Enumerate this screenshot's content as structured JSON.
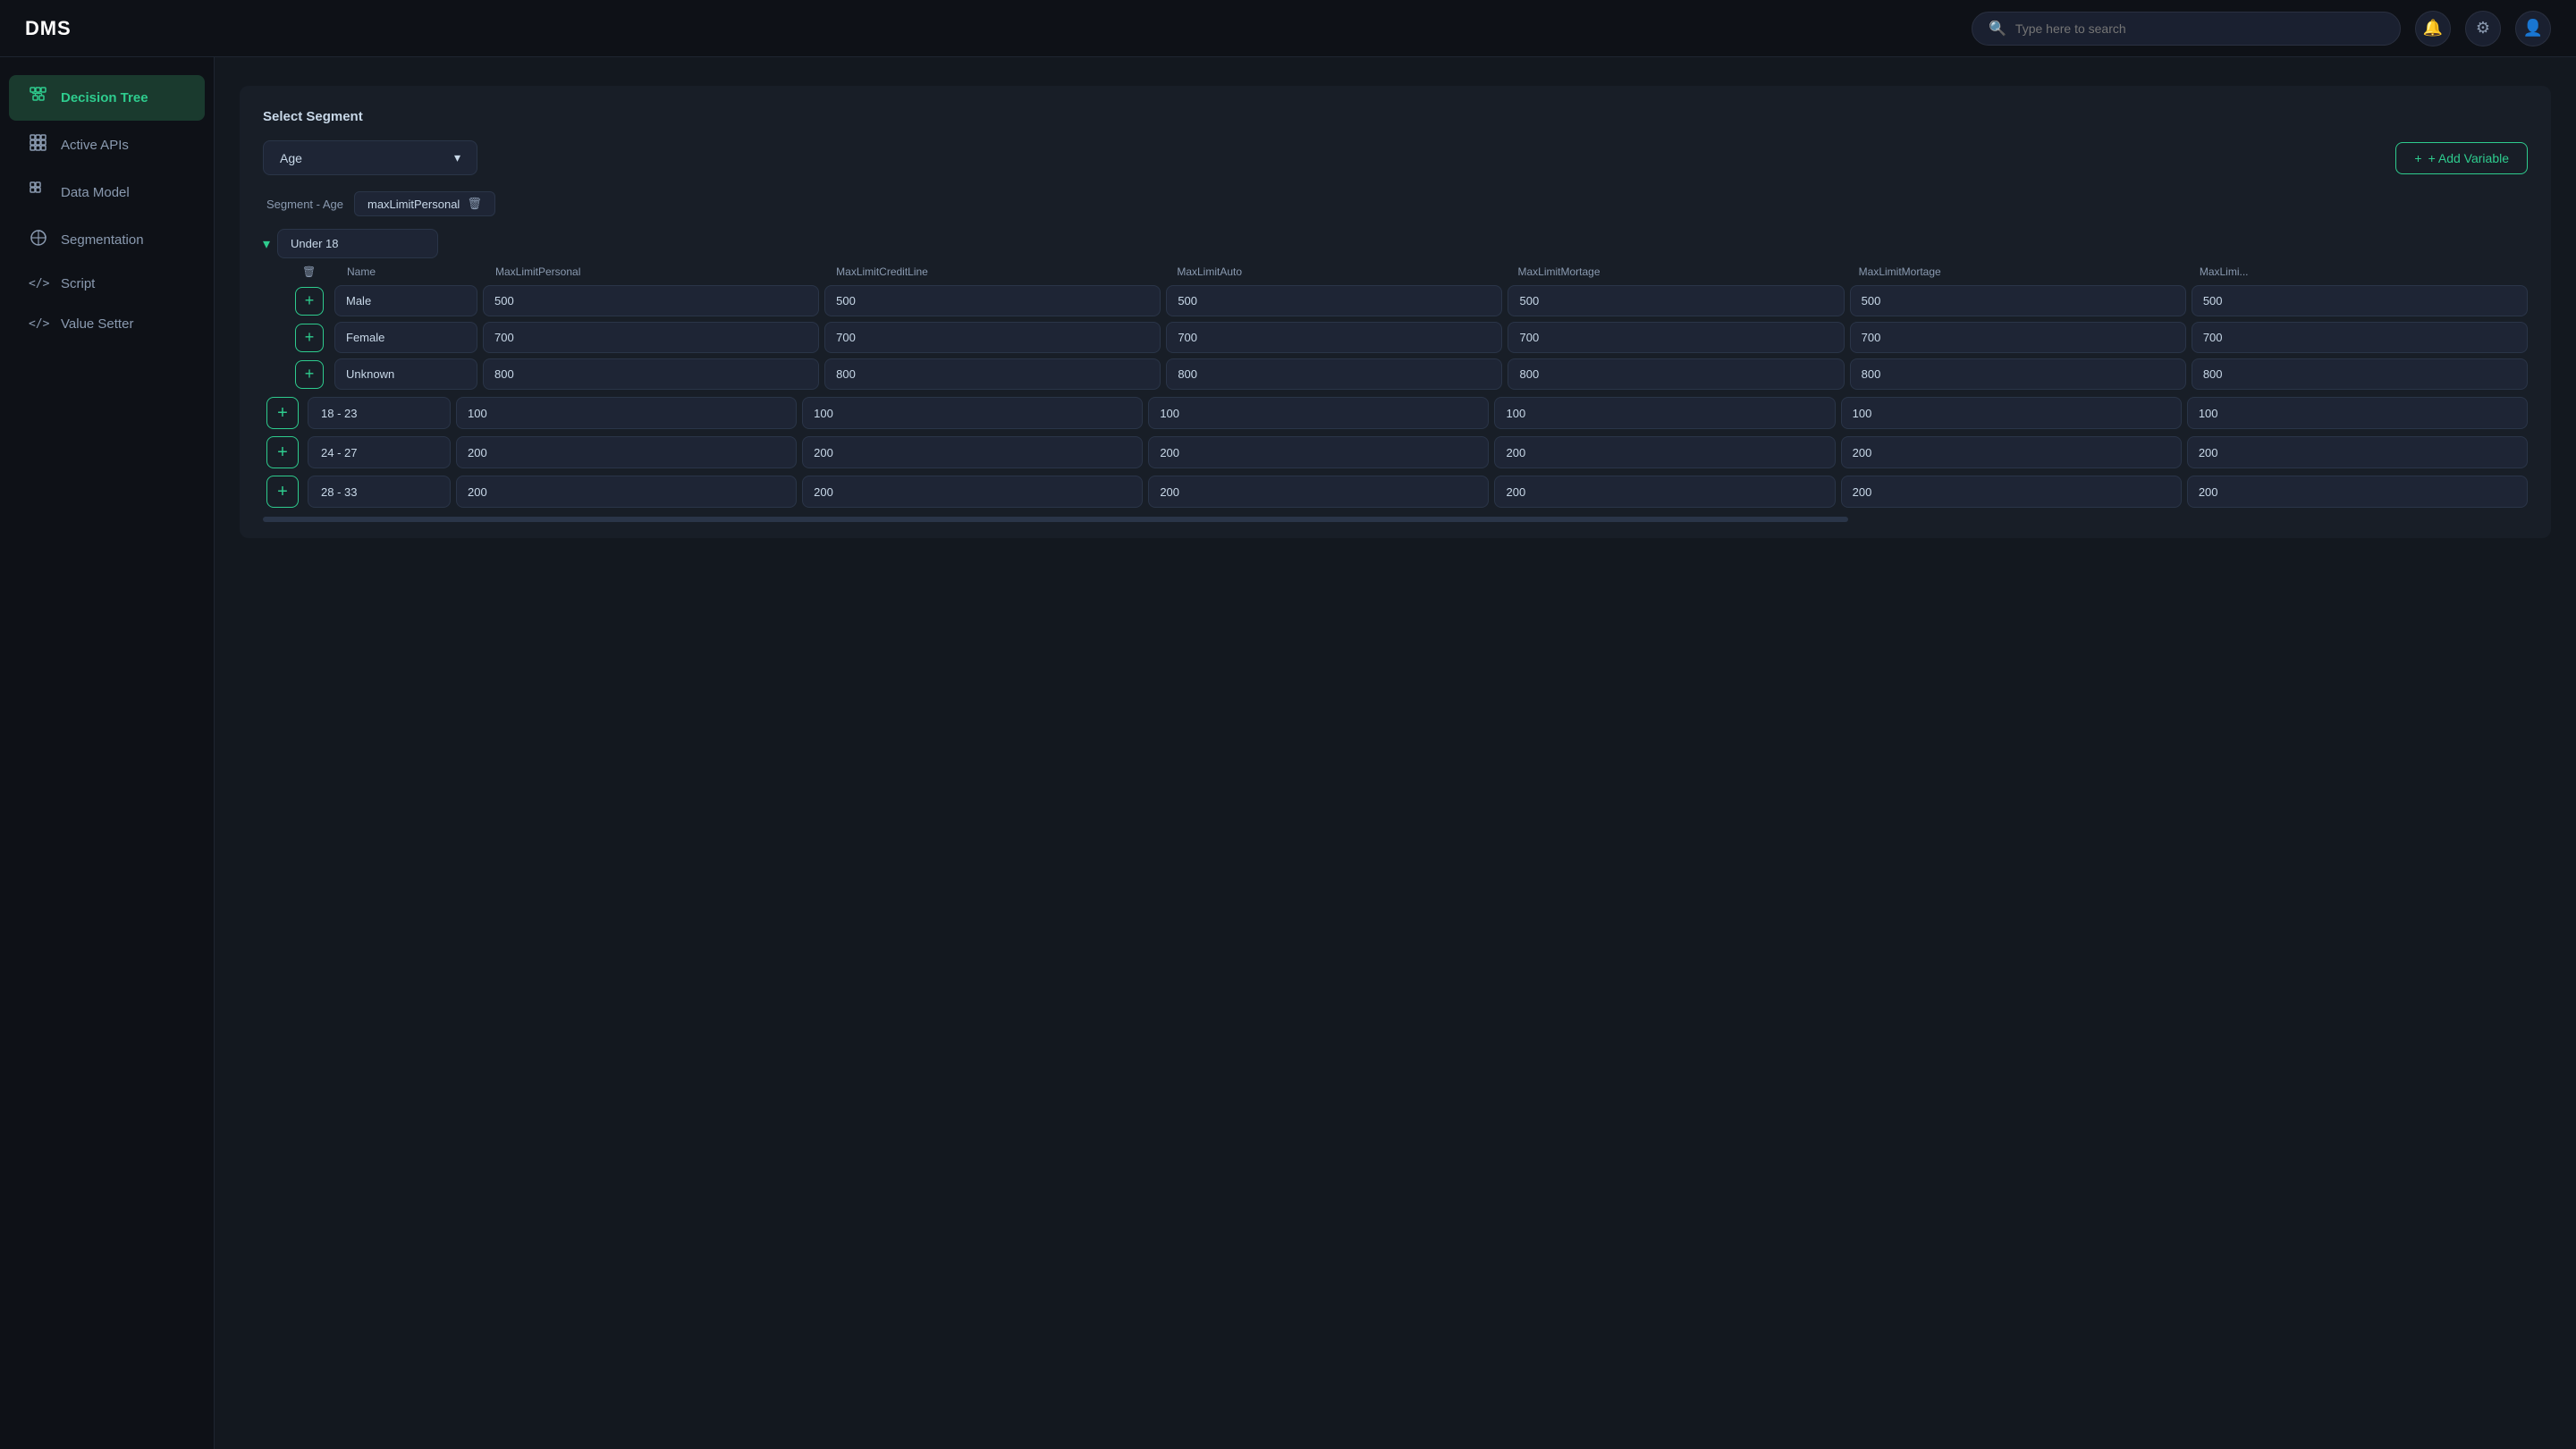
{
  "app": {
    "title": "DMS"
  },
  "topbar": {
    "search_placeholder": "Type here to search",
    "bell_icon": "🔔",
    "gear_icon": "⚙",
    "user_icon": "👤"
  },
  "sidebar": {
    "items": [
      {
        "id": "decision-tree",
        "label": "Decision Tree",
        "icon": "⊞",
        "active": true
      },
      {
        "id": "active-apis",
        "label": "Active APIs",
        "icon": "⊞",
        "active": false
      },
      {
        "id": "data-model",
        "label": "Data Model",
        "icon": "⊞",
        "active": false
      },
      {
        "id": "segmentation",
        "label": "Segmentation",
        "icon": "◎",
        "active": false
      },
      {
        "id": "script",
        "label": "Script",
        "icon": "</>",
        "active": false
      },
      {
        "id": "value-setter",
        "label": "Value Setter",
        "icon": "</>",
        "active": false
      }
    ]
  },
  "main": {
    "select_segment_label": "Select Segment",
    "segment_dropdown_value": "Age",
    "segment_dropdown_chevron": "▾",
    "add_variable_label": "+ Add Variable",
    "segment_label_text": "Segment  - Age",
    "variable_tag_text": "maxLimitPersonal",
    "variable_tag_delete": "🗑",
    "table_columns": [
      {
        "key": "delete",
        "label": "🗑"
      },
      {
        "key": "name",
        "label": "Name"
      },
      {
        "key": "col1",
        "label": "MaxLimitPersonal"
      },
      {
        "key": "col2",
        "label": "MaxLimitCreditLine"
      },
      {
        "key": "col3",
        "label": "MaxLimitAuto"
      },
      {
        "key": "col4",
        "label": "MaxLimitMortage"
      },
      {
        "key": "col5",
        "label": "MaxLimitMortage"
      },
      {
        "key": "col6",
        "label": "MaxLimi..."
      }
    ],
    "sections": [
      {
        "id": "under18",
        "range": "Under 18",
        "collapsed": false,
        "sub_rows": [
          {
            "name": "Male",
            "c1": "500",
            "c2": "500",
            "c3": "500",
            "c4": "500",
            "c5": "500",
            "c6": "500"
          },
          {
            "name": "Female",
            "c1": "700",
            "c2": "700",
            "c3": "700",
            "c4": "700",
            "c5": "700",
            "c6": "700"
          },
          {
            "name": "Unknown",
            "c1": "800",
            "c2": "800",
            "c3": "800",
            "c4": "800",
            "c5": "800",
            "c6": "800"
          }
        ]
      },
      {
        "id": "18-23",
        "range": "18 - 23",
        "collapsed": true,
        "values": {
          "c1": "100",
          "c2": "100",
          "c3": "100",
          "c4": "100",
          "c5": "100",
          "c6": "100"
        }
      },
      {
        "id": "24-27",
        "range": "24 - 27",
        "collapsed": true,
        "values": {
          "c1": "200",
          "c2": "200",
          "c3": "200",
          "c4": "200",
          "c5": "200",
          "c6": "200"
        }
      },
      {
        "id": "28-33",
        "range": "28 - 33",
        "collapsed": true,
        "values": {
          "c1": "200",
          "c2": "200",
          "c3": "200",
          "c4": "200",
          "c5": "200",
          "c6": "200"
        }
      }
    ]
  }
}
